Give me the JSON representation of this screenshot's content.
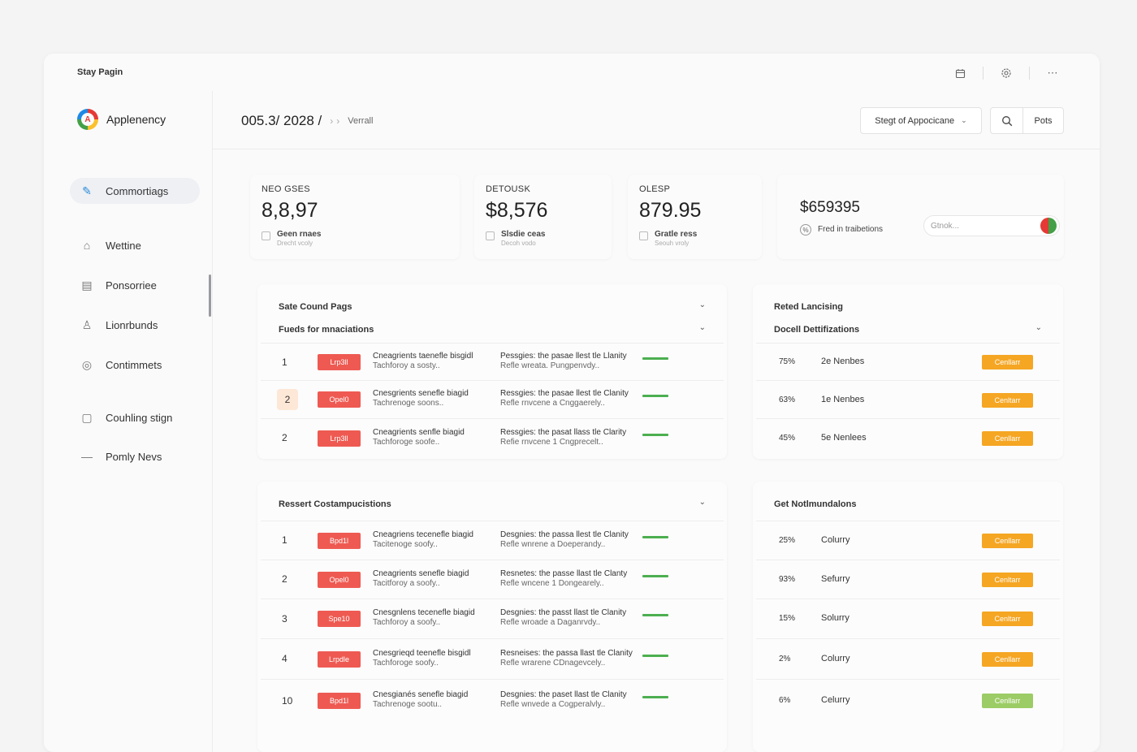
{
  "window": {
    "title": "Stay Pagin"
  },
  "top_icons": [
    "calendar-icon",
    "settings-icon",
    "more-icon"
  ],
  "brand": {
    "name": "Applenency"
  },
  "nav": [
    {
      "label": "Commortiags",
      "icon": "edit-icon",
      "glyph": "✎",
      "active": true
    },
    {
      "label": "Wettine",
      "icon": "home-icon",
      "glyph": "⌂"
    },
    {
      "label": "Ponsorriee",
      "icon": "document-icon",
      "glyph": "▤"
    },
    {
      "label": "Lionrbunds",
      "icon": "users-icon",
      "glyph": "♙"
    },
    {
      "label": "Contimmets",
      "icon": "chat-icon",
      "glyph": "◎"
    },
    {
      "label": "Couhling stign",
      "icon": "window-icon",
      "glyph": "▢"
    },
    {
      "label": "Pomly Nevs",
      "icon": "dash-icon",
      "glyph": "—"
    }
  ],
  "breadcrumb": {
    "date": "005.3/ 2028 /",
    "current": "Verrall"
  },
  "select": {
    "value": "Stegt of Appocicane"
  },
  "ports_label": "Pots",
  "stats": [
    {
      "label": "NEO GSES",
      "value": "8,8,97",
      "note": "Geen rnaes",
      "sub": "Drecht vcoly"
    },
    {
      "label": "DETOUSK",
      "value": "$8,576",
      "note": "Slsdie ceas",
      "sub": "Decoh vodo"
    },
    {
      "label": "OLESP",
      "value": "879.95",
      "note": "Gratle ress",
      "sub": "Seouh vroly"
    }
  ],
  "stat_wide": {
    "value": "$659395",
    "note": "Fred in traibetions",
    "input_placeholder": "Gtnok..."
  },
  "panel1": {
    "title": "Sate Cound Pags",
    "subtitle": "Fueds for mnaciations",
    "rows": [
      {
        "num": "1",
        "tag": "Lrp3ll",
        "a1": "Cneagrients taenefle bisgidl",
        "a2": "Tachforoy a sosty..",
        "b1": "Pessgies: the pasae llest tle Llanity",
        "b2": "Refle wreata. Pungpenvdy.."
      },
      {
        "num": "2",
        "tag": "Opel0",
        "a1": "Cnesgrients senefle biagid",
        "a2": "Tachrenoge soons..",
        "b1": "Ressgies: the pasae llest tle Clanity",
        "b2": "Refle rnvcene a Cnggaerely.."
      },
      {
        "num": "2",
        "tag": "Lrp3ll",
        "a1": "Cneagrients senfle biagid",
        "a2": "Tachforoge soofe..",
        "b1": "Ressgies: the pasat llass tle Clarity",
        "b2": "Refie rnvcene 1 Cngprecelt.."
      }
    ]
  },
  "panel2": {
    "title": "Ressert Costampucistions",
    "rows": [
      {
        "num": "1",
        "tag": "Bpd1l",
        "a1": "Cneagriens tecenefle biagid",
        "a2": "Tacitenoge soofy..",
        "b1": "Desgnies: the passa llest tle Clanity",
        "b2": "Refle wnrene a Doeperandy.."
      },
      {
        "num": "2",
        "tag": "Opel0",
        "a1": "Cneagrients senefle biagid",
        "a2": "Tacitforoy a soofy..",
        "b1": "Resnetes: the passe llast tle Clanty",
        "b2": "Refle wncene 1 Dongearely.."
      },
      {
        "num": "3",
        "tag": "Spe10",
        "a1": "Cnesgnlens tecenefle biagid",
        "a2": "Tachforoy a soofy..",
        "b1": "Desgnies: the passt llast tle Clanity",
        "b2": "Refle wroade a Daganrvdy.."
      },
      {
        "num": "4",
        "tag": "Lrpdle",
        "a1": "Cnesgrieqd teenefle bisgidl",
        "a2": "Tachforoge soofy..",
        "b1": "Resneises: the passa llast tle Clanity",
        "b2": "Refle wrarene CDnagevcely.."
      },
      {
        "num": "10",
        "tag": "Bpd1l",
        "a1": "Cnesgianés senefle biagid",
        "a2": "Tachrenoge sootu..",
        "b1": "Desgnies: the paset llast tle Clanity",
        "b2": "Refle wnvede a Cogperalvly.."
      }
    ]
  },
  "panel3": {
    "title": "Reted Lancising",
    "subtitle": "Docell Dettifizations",
    "rows": [
      {
        "pct": "75%",
        "name": "2e Nenbes",
        "btn": "Cenllarr"
      },
      {
        "pct": "63%",
        "name": "1e Nenbes",
        "btn": "Cenltarr"
      },
      {
        "pct": "45%",
        "name": "5e Nenlees",
        "btn": "Cenllarr"
      }
    ]
  },
  "panel4": {
    "title": "Get Notlmundalons",
    "rows": [
      {
        "pct": "25%",
        "name": "Colurry",
        "btn": "Cenllarr",
        "green": false
      },
      {
        "pct": "93%",
        "name": "Sefurry",
        "btn": "Cenltarr",
        "green": false
      },
      {
        "pct": "15%",
        "name": "Solurry",
        "btn": "Cenltarr",
        "green": false
      },
      {
        "pct": "2%",
        "name": "Colurry",
        "btn": "Cenllarr",
        "green": false
      },
      {
        "pct": "6%",
        "name": "Celurry",
        "btn": "Cenllarr",
        "green": true
      }
    ]
  },
  "colors": {
    "accent": "#2b8bd8",
    "tag_red": "#ee5a52",
    "button_orange": "#f5a623",
    "button_green": "#9ccc65",
    "progress_green": "#4caf50"
  }
}
